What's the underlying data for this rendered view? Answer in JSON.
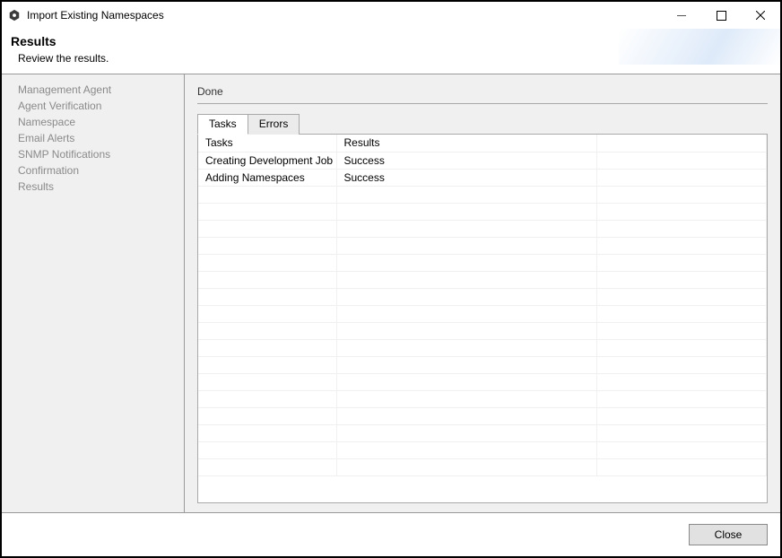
{
  "window": {
    "title": "Import Existing Namespaces"
  },
  "header": {
    "title": "Results",
    "subtitle": "Review the results."
  },
  "sidebar": {
    "items": [
      "Management Agent",
      "Agent Verification",
      "Namespace",
      "Email Alerts",
      "SNMP Notifications",
      "Confirmation",
      "Results"
    ]
  },
  "content": {
    "status": "Done",
    "tabs": {
      "tasks": "Tasks",
      "errors": "Errors"
    },
    "table": {
      "headers": {
        "tasks": "Tasks",
        "results": "Results"
      },
      "rows": [
        {
          "task": "Creating Development Job",
          "result": "Success"
        },
        {
          "task": "Adding Namespaces",
          "result": "Success"
        }
      ]
    }
  },
  "footer": {
    "close": "Close"
  }
}
